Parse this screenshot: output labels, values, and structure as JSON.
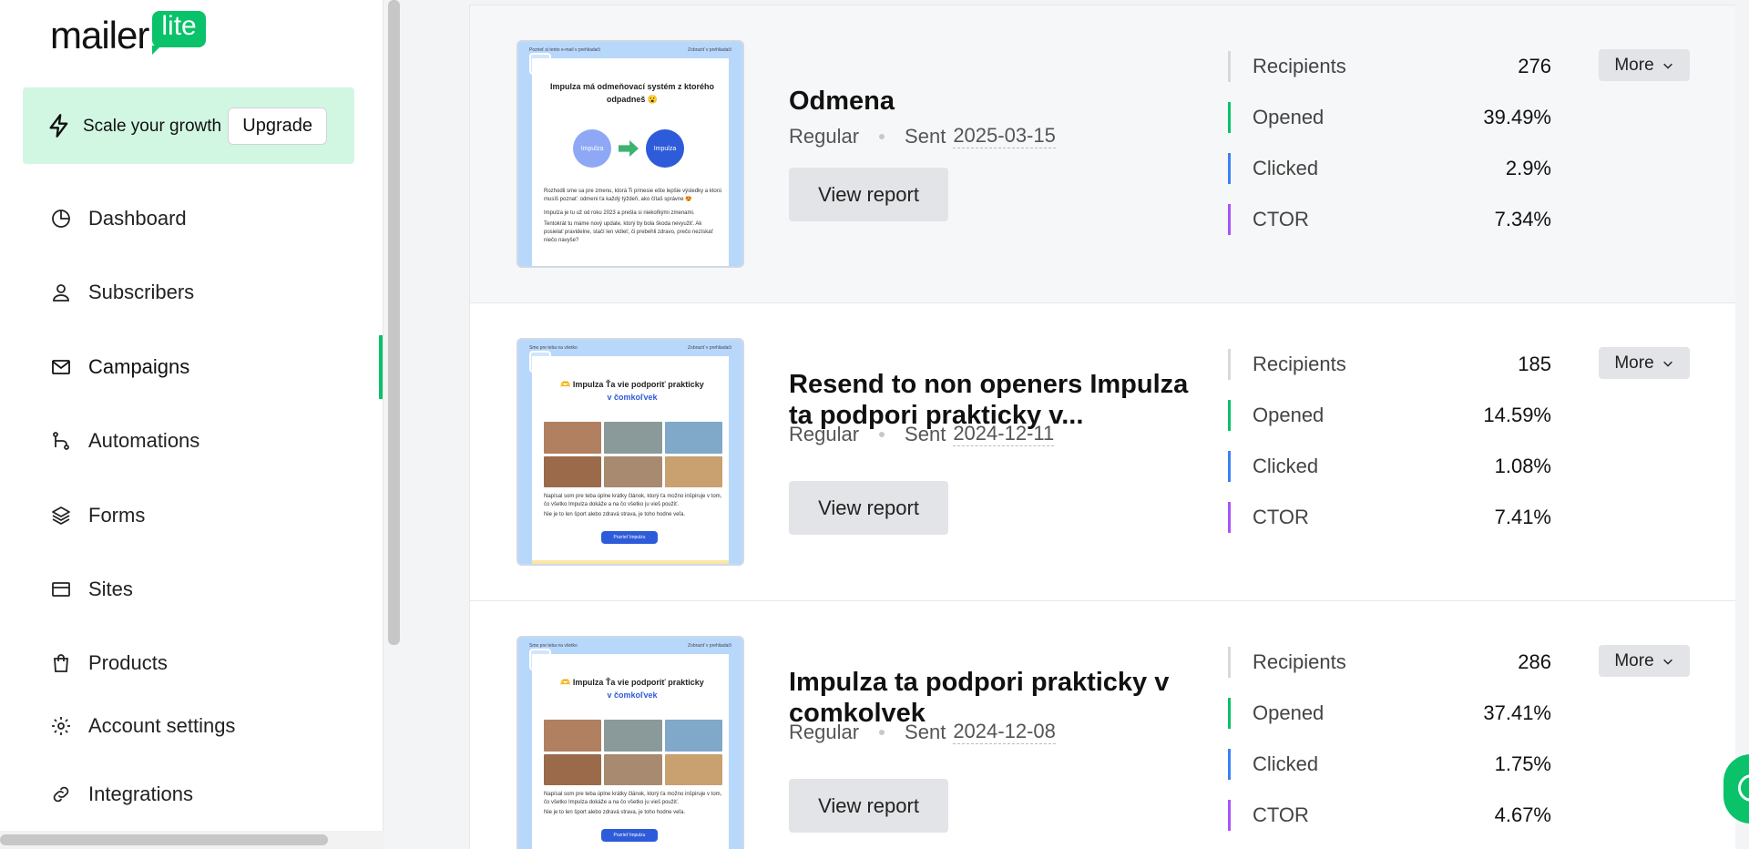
{
  "brand": {
    "logo_word": "mailer",
    "logo_badge": "lite",
    "accent": "#09c269"
  },
  "upgrade": {
    "text": "Scale your growth",
    "button": "Upgrade"
  },
  "sidebar": {
    "items": [
      {
        "label": "Dashboard",
        "icon": "pie-chart-icon"
      },
      {
        "label": "Subscribers",
        "icon": "user-icon"
      },
      {
        "label": "Campaigns",
        "icon": "mail-icon",
        "active": true
      },
      {
        "label": "Automations",
        "icon": "automation-icon"
      },
      {
        "label": "Forms",
        "icon": "layers-icon"
      },
      {
        "label": "Sites",
        "icon": "browser-icon"
      },
      {
        "label": "Products",
        "icon": "shopping-bag-icon"
      },
      {
        "label": "Account settings",
        "icon": "gear-icon"
      },
      {
        "label": "Integrations",
        "icon": "link-icon"
      }
    ]
  },
  "campaigns": [
    {
      "title": "Odmena",
      "type": "Regular",
      "sent_label": "Sent",
      "sent_date": "2025-03-15",
      "view_report": "View report",
      "more": "More",
      "stats": [
        {
          "label": "Recipients",
          "value": "276",
          "color": "#d9d9d9"
        },
        {
          "label": "Opened",
          "value": "39.49%",
          "color": "#09c269"
        },
        {
          "label": "Clicked",
          "value": "2.9%",
          "color": "#3b82f6"
        },
        {
          "label": "CTOR",
          "value": "7.34%",
          "color": "#a855f7"
        }
      ],
      "thumb": {
        "preheader_left": "Pozrieť si tento e-mail v prehliadači",
        "preheader_right": "Zobraziť v prehliadači",
        "headline": "Impulza má odmeňovací systém z ktorého odpadneš 😮",
        "circle_a": "Impulza",
        "circle_b": "Impulza",
        "body": [
          "Rozhodli sme sa pre zmenu, ktorá Ti prinesie ešte lepšie výsledky a ktorú musíš poznať: odmeni ťa každý týždeň, ako čítaš správne 😍",
          "Impulza je tu už od roku 2023 a prešla si niekoľkými zmenami.",
          "Tentokrát tu máme nový update, ktorý by bola škoda nevyužiť. Ak posielať pravidelne, stačí len vidieť, či prebehli zdravo, prečo nezískať niečo navyše?"
        ]
      }
    },
    {
      "title": "Resend to non openers Impulza ta podpori prakticky v...",
      "type": "Regular",
      "sent_label": "Sent",
      "sent_date": "2024-12-11",
      "view_report": "View report",
      "more": "More",
      "stats": [
        {
          "label": "Recipients",
          "value": "185",
          "color": "#d9d9d9"
        },
        {
          "label": "Opened",
          "value": "14.59%",
          "color": "#09c269"
        },
        {
          "label": "Clicked",
          "value": "1.08%",
          "color": "#3b82f6"
        },
        {
          "label": "CTOR",
          "value": "7.41%",
          "color": "#a855f7"
        }
      ],
      "thumb": {
        "preheader_left": "Sme pre teba na všetko",
        "preheader_right": "Zobraziť v prehliadači",
        "headline": "🫶 Impulza Ťa vie podporiť prakticky",
        "headline_blue": "v čomkoľvek",
        "body": [
          "Napísal som pre teba úplne krátky článok, ktorý ťa možno inšpiruje v tom, čo všetko Impulza dokáže a na čo všetko ju vieš použiť.",
          "Nie je to len šport alebo zdravá strava, je toho hodne veľa."
        ],
        "cta": "Pozrieť Impulzu"
      }
    },
    {
      "title": "Impulza ta podpori prakticky v comkolvek",
      "type": "Regular",
      "sent_label": "Sent",
      "sent_date": "2024-12-08",
      "view_report": "View report",
      "more": "More",
      "stats": [
        {
          "label": "Recipients",
          "value": "286",
          "color": "#d9d9d9"
        },
        {
          "label": "Opened",
          "value": "37.41%",
          "color": "#09c269"
        },
        {
          "label": "Clicked",
          "value": "1.75%",
          "color": "#3b82f6"
        },
        {
          "label": "CTOR",
          "value": "4.67%",
          "color": "#a855f7"
        }
      ],
      "thumb": {
        "preheader_left": "Sme pre teba na všetko",
        "preheader_right": "Zobraziť v prehliadači",
        "headline": "🫶 Impulza Ťa vie podporiť prakticky",
        "headline_blue": "v čomkoľvek",
        "body": [
          "Napísal som pre teba úplne krátky článok, ktorý ťa možno inšpiruje v tom, čo všetko Impulza dokáže a na čo všetko ju vieš použiť.",
          "Nie je to len šport alebo zdravá strava, je toho hodne veľa."
        ],
        "cta": "Pozrieť Impulzu"
      }
    }
  ]
}
